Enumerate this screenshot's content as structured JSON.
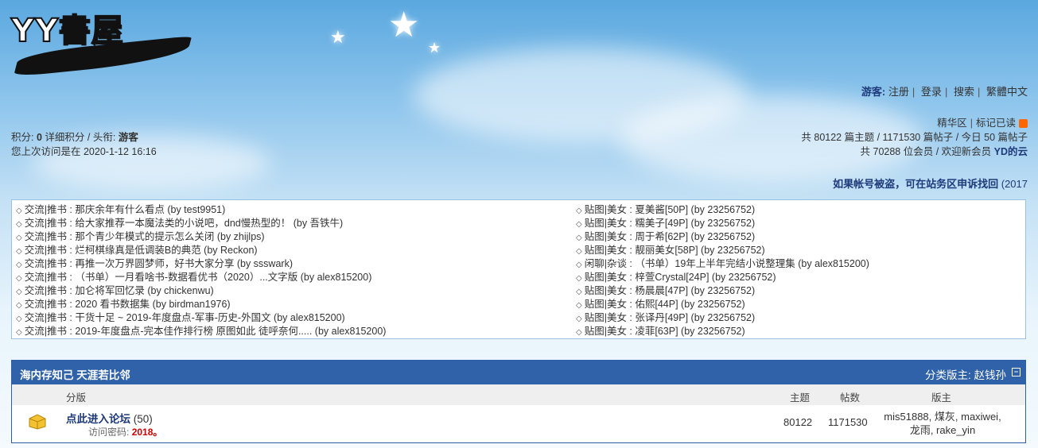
{
  "logo": {
    "text": "YY書屋"
  },
  "header": {
    "guest_label": "游客:",
    "links": [
      "注册",
      "登录",
      "搜索",
      "繁體中文"
    ]
  },
  "user": {
    "points_label": "积分:",
    "points_value": "0",
    "detail_label": "详细积分",
    "title_label": "/ 头衔:",
    "title_value": "游客",
    "last_visit": "您上次访问是在 2020-1-12 16:16"
  },
  "stats": {
    "digest": "精华区",
    "mark_read": "标记已读",
    "line1": "共 80122 篇主题 / 1171530 篇帖子 / 今日 50 篇帖子",
    "line2_prefix": "共 70288 位会员 / 欢迎新会员",
    "newest_member": "YD的云"
  },
  "notice": {
    "text": "如果帐号被盗，可在站务区申诉找回",
    "suffix": "(2017"
  },
  "threads_left": [
    "交流|推书 : 那庆余年有什么看点 (by test9951)",
    "交流|推书 : 给大家推荐一本魔法类的小说吧，dnd慢热型的！ (by 吾铁牛)",
    "交流|推书 : 那个青少年模式的提示怎么关闭 (by zhijlps)",
    "交流|推书 : 烂柯棋缘真是低调装B的典范 (by Reckon)",
    "交流|推书 : 再推一次万界圆梦师，好书大家分享 (by ssswark)",
    "交流|推书 : （书单）一月看啥书-数据看优书（2020）...文字版 (by alex815200)",
    "交流|推书 : 加仑将军回忆录 (by chickenwu)",
    "交流|推书 : 2020 看书数据集 (by birdman1976)",
    "交流|推书 : 干货十足 ~ 2019-年度盘点-军事-历史-外国文 (by alex815200)",
    "交流|推书 : 2019-年度盘点-完本佳作排行榜 原图如此 徒呼奈何..... (by alex815200)"
  ],
  "threads_right": [
    "贴图|美女 : 夏美酱[50P] (by 23256752)",
    "贴图|美女 : 糯美子[49P] (by 23256752)",
    "贴图|美女 : 周于希[62P] (by 23256752)",
    "贴图|美女 : 靓丽美女[58P] (by 23256752)",
    "闲聊|杂谈 : （书单）19年上半年完结小说整理集 (by alex815200)",
    "贴图|美女 : 梓萱Crystal[24P] (by 23256752)",
    "贴图|美女 : 杨晨晨[47P] (by 23256752)",
    "贴图|美女 : 佑熙[44P] (by 23256752)",
    "贴图|美女 : 张译丹[49P] (by 23256752)",
    "贴图|美女 : 凌菲[63P] (by 23256752)"
  ],
  "forum": {
    "title": "海内存知己 天涯若比邻",
    "moderator": "分类版主: 赵钱孙",
    "toggle": "−",
    "col_board": "分版",
    "col_topics": "主题",
    "col_posts": "帖数",
    "col_mods": "版主",
    "board_name": "点此进入论坛",
    "board_count": "(50)",
    "password_label": "访问密码:",
    "password_value": "2018。",
    "topics": "80122",
    "posts": "1171530",
    "mods_line1": "mis51888, 煤灰, maxiwei,",
    "mods_line2": "龙雨, rake_yin"
  }
}
